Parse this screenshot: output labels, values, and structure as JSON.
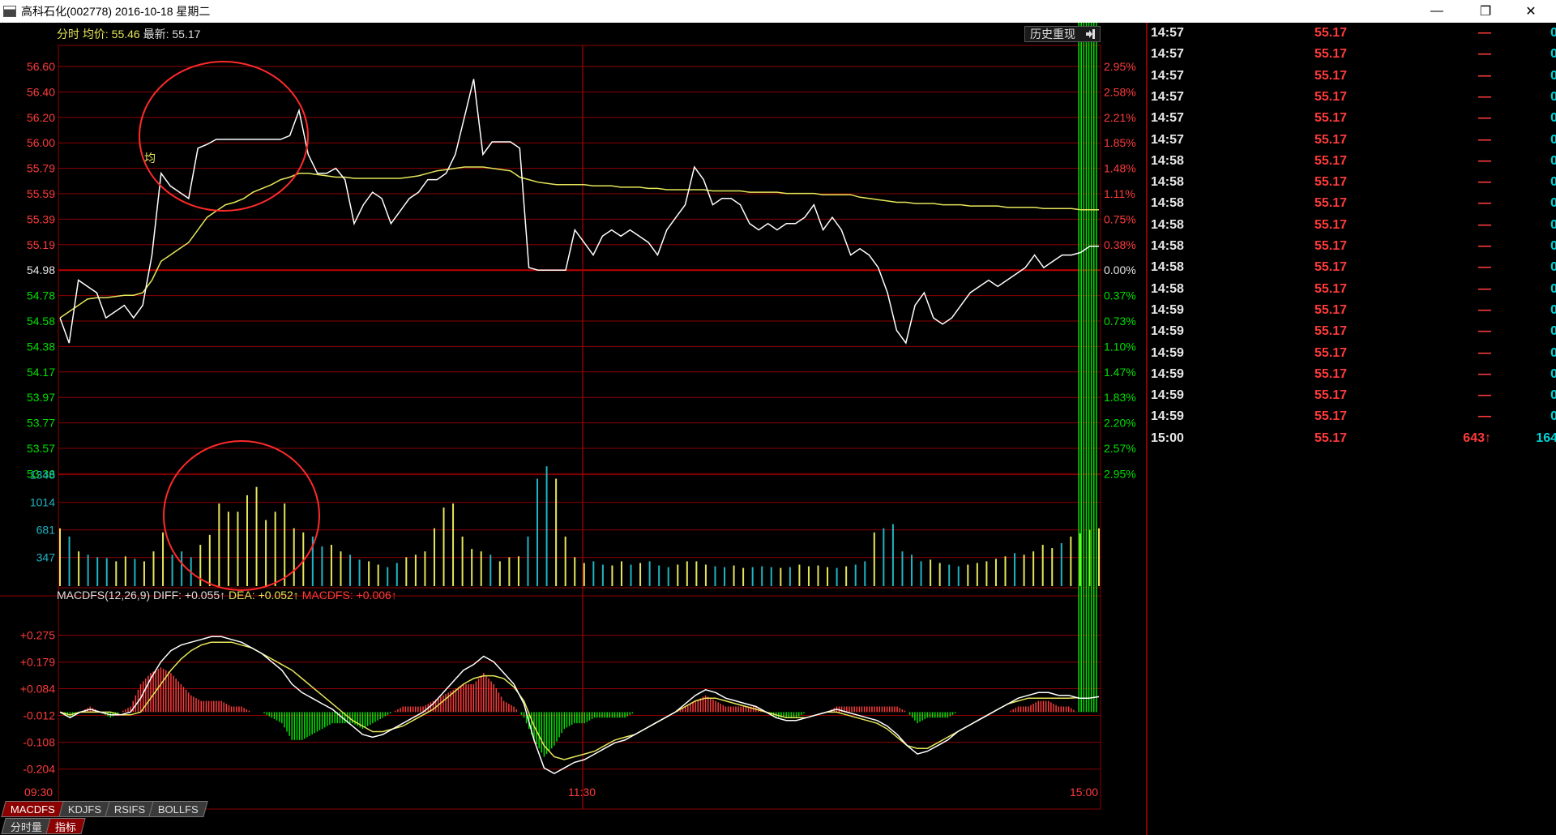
{
  "window": {
    "title": "高科石化(002778) 2016-10-18 星期二",
    "min_label": "—",
    "max_label": "❐",
    "close_label": "✕"
  },
  "header": {
    "mode_label": "分时",
    "avg_label": "均价:",
    "avg_value": "55.46",
    "last_label": "最新:",
    "last_value": "55.17"
  },
  "history_button": {
    "label": "历史重现",
    "icon": "exit-arrow-icon"
  },
  "colors": {
    "up": "#ff3b3b",
    "down": "#00e000",
    "price_line": "#ffffff",
    "avg_line": "#e6e65a",
    "grid": "#8b0000",
    "volume": "#1fb5c4",
    "circle": "#ff2a2a"
  },
  "price_axis": {
    "left": [
      "56.60",
      "56.40",
      "56.20",
      "56.00",
      "55.79",
      "55.59",
      "55.39",
      "55.19",
      "54.98",
      "54.78",
      "54.58",
      "54.38",
      "54.17",
      "53.97",
      "53.77",
      "53.57",
      "53.36"
    ],
    "right": [
      "2.95%",
      "2.58%",
      "2.21%",
      "1.85%",
      "1.48%",
      "1.11%",
      "0.75%",
      "0.38%",
      "0.00%",
      "0.37%",
      "0.73%",
      "1.10%",
      "1.47%",
      "1.83%",
      "2.20%",
      "2.57%",
      "2.95%"
    ],
    "base_index": 8
  },
  "volume_axis": {
    "labels": [
      "1348",
      "1014",
      "681",
      "347"
    ]
  },
  "macd": {
    "title": "MACDFS(12,26,9)",
    "diff_label": "DIFF: +0.055↑",
    "dea_label": "DEA: +0.052↑",
    "macdfs_label": "MACDFS: +0.006↑",
    "axis": [
      "+0.275",
      "+0.179",
      "+0.084",
      "-0.012",
      "-0.108",
      "-0.204"
    ]
  },
  "time_axis": {
    "start": "09:30",
    "mid": "11:30",
    "end": "15:00"
  },
  "annotation": {
    "label": "均"
  },
  "tabs": [
    {
      "label": "MACDFS",
      "active": true
    },
    {
      "label": "KDJFS",
      "active": false
    },
    {
      "label": "RSIFS",
      "active": false
    },
    {
      "label": "BOLLFS",
      "active": false
    }
  ],
  "bottom_tabs": [
    {
      "label": "分时量",
      "active": false
    },
    {
      "label": "指标",
      "active": true
    }
  ],
  "ticks": [
    {
      "time": "14:57",
      "price": "55.17",
      "vol": "—",
      "num": "0"
    },
    {
      "time": "14:57",
      "price": "55.17",
      "vol": "—",
      "num": "0"
    },
    {
      "time": "14:57",
      "price": "55.17",
      "vol": "—",
      "num": "0"
    },
    {
      "time": "14:57",
      "price": "55.17",
      "vol": "—",
      "num": "0"
    },
    {
      "time": "14:57",
      "price": "55.17",
      "vol": "—",
      "num": "0"
    },
    {
      "time": "14:57",
      "price": "55.17",
      "vol": "—",
      "num": "0"
    },
    {
      "time": "14:58",
      "price": "55.17",
      "vol": "—",
      "num": "0"
    },
    {
      "time": "14:58",
      "price": "55.17",
      "vol": "—",
      "num": "0"
    },
    {
      "time": "14:58",
      "price": "55.17",
      "vol": "—",
      "num": "0"
    },
    {
      "time": "14:58",
      "price": "55.17",
      "vol": "—",
      "num": "0"
    },
    {
      "time": "14:58",
      "price": "55.17",
      "vol": "—",
      "num": "0"
    },
    {
      "time": "14:58",
      "price": "55.17",
      "vol": "—",
      "num": "0"
    },
    {
      "time": "14:58",
      "price": "55.17",
      "vol": "—",
      "num": "0"
    },
    {
      "time": "14:59",
      "price": "55.17",
      "vol": "—",
      "num": "0"
    },
    {
      "time": "14:59",
      "price": "55.17",
      "vol": "—",
      "num": "0"
    },
    {
      "time": "14:59",
      "price": "55.17",
      "vol": "—",
      "num": "0"
    },
    {
      "time": "14:59",
      "price": "55.17",
      "vol": "—",
      "num": "0"
    },
    {
      "time": "14:59",
      "price": "55.17",
      "vol": "—",
      "num": "0"
    },
    {
      "time": "14:59",
      "price": "55.17",
      "vol": "—",
      "num": "0"
    },
    {
      "time": "15:00",
      "price": "55.17",
      "vol": "643↑",
      "num": "164"
    }
  ],
  "chart_data": {
    "type": "line",
    "session": [
      "09:30",
      "11:30",
      "15:00"
    ],
    "base_price": 54.98,
    "price_range": [
      53.36,
      56.6
    ],
    "price": [
      54.6,
      54.4,
      54.9,
      54.85,
      54.8,
      54.6,
      54.65,
      54.7,
      54.6,
      54.7,
      55.1,
      55.75,
      55.65,
      55.6,
      55.55,
      55.95,
      55.98,
      56.02,
      56.02,
      56.02,
      56.02,
      56.02,
      56.02,
      56.02,
      56.02,
      56.05,
      56.25,
      55.9,
      55.75,
      55.75,
      55.79,
      55.7,
      55.35,
      55.5,
      55.6,
      55.55,
      55.35,
      55.45,
      55.55,
      55.6,
      55.7,
      55.7,
      55.75,
      55.9,
      56.2,
      56.5,
      55.9,
      56.0,
      56.0,
      56.0,
      55.95,
      55.0,
      54.98,
      54.98,
      54.98,
      54.98,
      55.3,
      55.2,
      55.1,
      55.25,
      55.3,
      55.25,
      55.3,
      55.25,
      55.2,
      55.1,
      55.3,
      55.4,
      55.5,
      55.8,
      55.7,
      55.5,
      55.55,
      55.55,
      55.5,
      55.35,
      55.3,
      55.35,
      55.3,
      55.35,
      55.35,
      55.4,
      55.5,
      55.3,
      55.4,
      55.3,
      55.1,
      55.15,
      55.1,
      55.0,
      54.8,
      54.5,
      54.4,
      54.7,
      54.8,
      54.6,
      54.55,
      54.6,
      54.7,
      54.8,
      54.85,
      54.9,
      54.85,
      54.9,
      54.95,
      55.0,
      55.1,
      55.0,
      55.05,
      55.1,
      55.1,
      55.12,
      55.17,
      55.17
    ],
    "avg": [
      54.6,
      54.65,
      54.7,
      54.75,
      54.76,
      54.76,
      54.77,
      54.78,
      54.78,
      54.8,
      54.9,
      55.05,
      55.1,
      55.15,
      55.2,
      55.3,
      55.4,
      55.45,
      55.5,
      55.52,
      55.55,
      55.6,
      55.63,
      55.66,
      55.7,
      55.72,
      55.75,
      55.75,
      55.74,
      55.73,
      55.72,
      55.72,
      55.71,
      55.71,
      55.71,
      55.71,
      55.71,
      55.71,
      55.72,
      55.73,
      55.75,
      55.77,
      55.78,
      55.79,
      55.8,
      55.8,
      55.8,
      55.79,
      55.78,
      55.77,
      55.72,
      55.7,
      55.68,
      55.67,
      55.66,
      55.66,
      55.66,
      55.66,
      55.65,
      55.65,
      55.65,
      55.64,
      55.64,
      55.64,
      55.63,
      55.63,
      55.62,
      55.62,
      55.62,
      55.62,
      55.62,
      55.61,
      55.61,
      55.61,
      55.61,
      55.6,
      55.6,
      55.6,
      55.6,
      55.59,
      55.59,
      55.59,
      55.59,
      55.58,
      55.58,
      55.58,
      55.58,
      55.56,
      55.55,
      55.54,
      55.53,
      55.52,
      55.52,
      55.51,
      55.51,
      55.51,
      55.5,
      55.5,
      55.5,
      55.49,
      55.49,
      55.49,
      55.49,
      55.48,
      55.48,
      55.48,
      55.48,
      55.47,
      55.47,
      55.47,
      55.47,
      55.46,
      55.46,
      55.46
    ],
    "volume": [
      700,
      600,
      420,
      380,
      350,
      340,
      300,
      360,
      330,
      300,
      420,
      650,
      380,
      420,
      350,
      500,
      620,
      1000,
      900,
      900,
      1100,
      1200,
      800,
      900,
      1000,
      700,
      650,
      600,
      480,
      500,
      420,
      380,
      320,
      300,
      260,
      230,
      280,
      350,
      380,
      420,
      700,
      950,
      1000,
      600,
      450,
      420,
      380,
      300,
      350,
      360,
      600,
      1300,
      1450,
      1300,
      600,
      350,
      280,
      300,
      260,
      250,
      300,
      260,
      280,
      300,
      250,
      230,
      260,
      300,
      300,
      260,
      240,
      230,
      250,
      220,
      230,
      240,
      230,
      220,
      230,
      260,
      240,
      250,
      230,
      220,
      240,
      260,
      300,
      650,
      700,
      750,
      420,
      380,
      300,
      320,
      280,
      260,
      240,
      260,
      280,
      300,
      330,
      360,
      400,
      380,
      420,
      500,
      460,
      520,
      600,
      640,
      680,
      700
    ],
    "macd_diff": [
      0.0,
      -0.02,
      0.0,
      0.01,
      0.0,
      -0.01,
      -0.01,
      0.0,
      0.05,
      0.12,
      0.18,
      0.22,
      0.24,
      0.25,
      0.26,
      0.27,
      0.27,
      0.26,
      0.25,
      0.23,
      0.21,
      0.18,
      0.15,
      0.1,
      0.07,
      0.05,
      0.03,
      0.01,
      -0.02,
      -0.05,
      -0.08,
      -0.09,
      -0.08,
      -0.06,
      -0.04,
      -0.02,
      0.0,
      0.03,
      0.07,
      0.11,
      0.15,
      0.17,
      0.2,
      0.18,
      0.14,
      0.1,
      0.03,
      -0.1,
      -0.2,
      -0.22,
      -0.2,
      -0.18,
      -0.17,
      -0.15,
      -0.13,
      -0.11,
      -0.1,
      -0.08,
      -0.06,
      -0.04,
      -0.02,
      0.0,
      0.03,
      0.06,
      0.08,
      0.07,
      0.05,
      0.04,
      0.03,
      0.02,
      0.0,
      -0.02,
      -0.03,
      -0.03,
      -0.02,
      -0.01,
      0.0,
      0.01,
      0.0,
      -0.01,
      -0.02,
      -0.03,
      -0.05,
      -0.08,
      -0.12,
      -0.15,
      -0.14,
      -0.12,
      -0.1,
      -0.07,
      -0.05,
      -0.03,
      -0.01,
      0.01,
      0.03,
      0.05,
      0.06,
      0.07,
      0.07,
      0.06,
      0.06,
      0.05,
      0.05,
      0.055
    ],
    "macd_dea": [
      0.0,
      -0.01,
      0.0,
      0.0,
      0.0,
      0.0,
      -0.01,
      -0.01,
      0.0,
      0.05,
      0.1,
      0.15,
      0.19,
      0.22,
      0.24,
      0.25,
      0.25,
      0.25,
      0.24,
      0.23,
      0.21,
      0.19,
      0.17,
      0.15,
      0.12,
      0.09,
      0.06,
      0.03,
      0.0,
      -0.03,
      -0.05,
      -0.07,
      -0.07,
      -0.06,
      -0.05,
      -0.03,
      -0.01,
      0.01,
      0.04,
      0.07,
      0.1,
      0.12,
      0.13,
      0.13,
      0.12,
      0.09,
      0.04,
      -0.05,
      -0.12,
      -0.16,
      -0.17,
      -0.16,
      -0.15,
      -0.14,
      -0.12,
      -0.1,
      -0.09,
      -0.08,
      -0.06,
      -0.04,
      -0.02,
      0.0,
      0.02,
      0.04,
      0.05,
      0.05,
      0.04,
      0.03,
      0.02,
      0.01,
      0.0,
      -0.01,
      -0.02,
      -0.02,
      -0.02,
      -0.01,
      0.0,
      0.0,
      -0.01,
      -0.02,
      -0.03,
      -0.04,
      -0.06,
      -0.09,
      -0.12,
      -0.13,
      -0.13,
      -0.11,
      -0.09,
      -0.07,
      -0.05,
      -0.03,
      -0.01,
      0.01,
      0.03,
      0.04,
      0.05,
      0.05,
      0.05,
      0.05,
      0.05,
      0.052
    ],
    "macd_range": [
      -0.26,
      0.3
    ]
  }
}
